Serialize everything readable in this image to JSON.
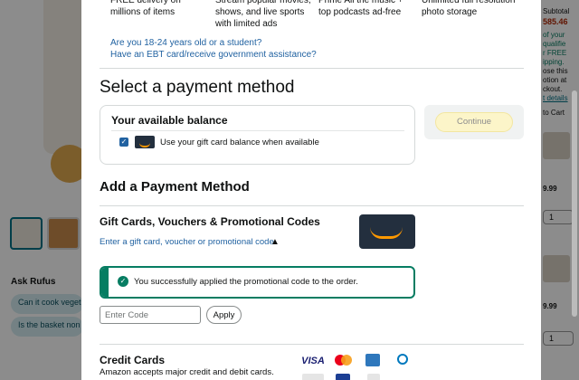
{
  "background": {
    "ask_rufus": "Ask Rufus",
    "rufus_chips": [
      "Can it cook veget",
      "Is the basket non"
    ],
    "right_panel": {
      "subtotal_label": "Subtotal",
      "subtotal_value": "585.46",
      "shipping_lines": [
        "of your",
        "qualifie",
        "r FREE",
        "ipping.",
        "ose this",
        "otion at",
        "ckout."
      ],
      "details_link": "t details",
      "to_cart": "to Cart",
      "price1": "9.99",
      "qty1": "1",
      "price2": "9.99",
      "qty2": "1"
    }
  },
  "modal": {
    "benefits": [
      {
        "text": "FREE delivery on millions of items"
      },
      {
        "text": "Stream popular movies, shows, and live sports with limited ads"
      },
      {
        "text": "Prime All the music + top podcasts ad-free"
      },
      {
        "text": "Unlimited full resolution photo storage"
      }
    ],
    "questions": {
      "student": "Are you 18-24 years old or a student?",
      "ebt": "Have an EBT card/receive government assistance?"
    },
    "select_payment_heading": "Select a payment method",
    "balance": {
      "title": "Your available balance",
      "checkbox_label": "Use your gift card balance when available",
      "checked": true
    },
    "continue_label": "Continue",
    "add_payment_heading": "Add a Payment Method",
    "gift_cards": {
      "title": "Gift Cards, Vouchers & Promotional Codes",
      "link": "Enter a gift card, voucher or promotional code",
      "success_message": "You successfully applied the promotional code to the order.",
      "code_placeholder": "Enter Code",
      "code_value": "",
      "apply_label": "Apply"
    },
    "credit_cards": {
      "title": "Credit Cards",
      "subtitle": "Amazon accepts major credit and debit cards.",
      "visa_text": "VISA"
    }
  },
  "colors": {
    "link": "#2162a1",
    "success": "#067d62",
    "continue_bg": "#fcf5c9",
    "amazon_orange": "#ff9900",
    "amazon_navy": "#232f3e"
  }
}
